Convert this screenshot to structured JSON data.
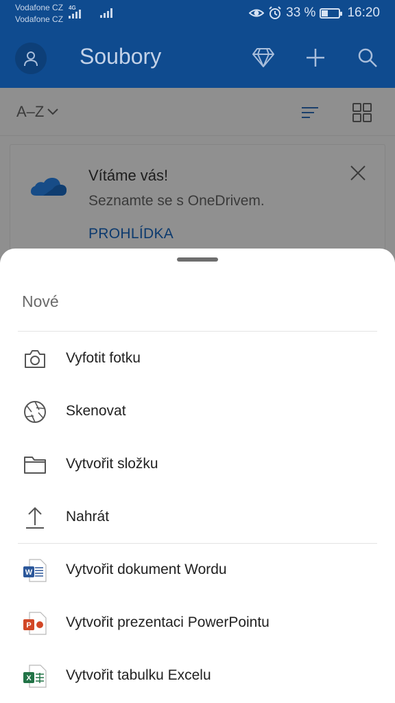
{
  "status_bar": {
    "carrier1": "Vodafone CZ",
    "carrier2": "Vodafone CZ",
    "network": "4G",
    "battery_percent": "33 %",
    "battery_level": 0.33,
    "time": "16:20",
    "icons": [
      "eye-comfort-icon",
      "alarm-icon",
      "battery-icon",
      "signal-icon"
    ]
  },
  "app_bar": {
    "title": "Soubory",
    "icons": [
      "avatar-icon",
      "diamond-icon",
      "plus-icon",
      "search-icon"
    ],
    "bg_color": "#0f4b8f"
  },
  "toolbar": {
    "sort_label": "A–Z",
    "icons": [
      "chevron-down-icon",
      "sort-lines-icon",
      "grid-view-icon"
    ]
  },
  "welcome": {
    "title": "Vítáme vás!",
    "subtitle": "Seznamte se s OneDrivem.",
    "link": "PROHLÍDKA",
    "icons": [
      "onedrive-cloud-icon",
      "close-icon"
    ]
  },
  "sheet": {
    "title": "Nové",
    "items": [
      {
        "label": "Vyfotit fotku",
        "icon": "camera-icon"
      },
      {
        "label": "Skenovat",
        "icon": "aperture-icon"
      },
      {
        "label": "Vytvořit složku",
        "icon": "folder-icon"
      },
      {
        "label": "Nahrát",
        "icon": "upload-icon"
      },
      {
        "label": "Vytvořit dokument Wordu",
        "icon": "word-icon"
      },
      {
        "label": "Vytvořit prezentaci PowerPointu",
        "icon": "powerpoint-icon"
      },
      {
        "label": "Vytvořit tabulku Excelu",
        "icon": "excel-icon"
      }
    ]
  },
  "colors": {
    "word": "#2b579a",
    "powerpoint": "#d24726",
    "excel": "#217346",
    "onedrive": "#1f6fc4"
  }
}
